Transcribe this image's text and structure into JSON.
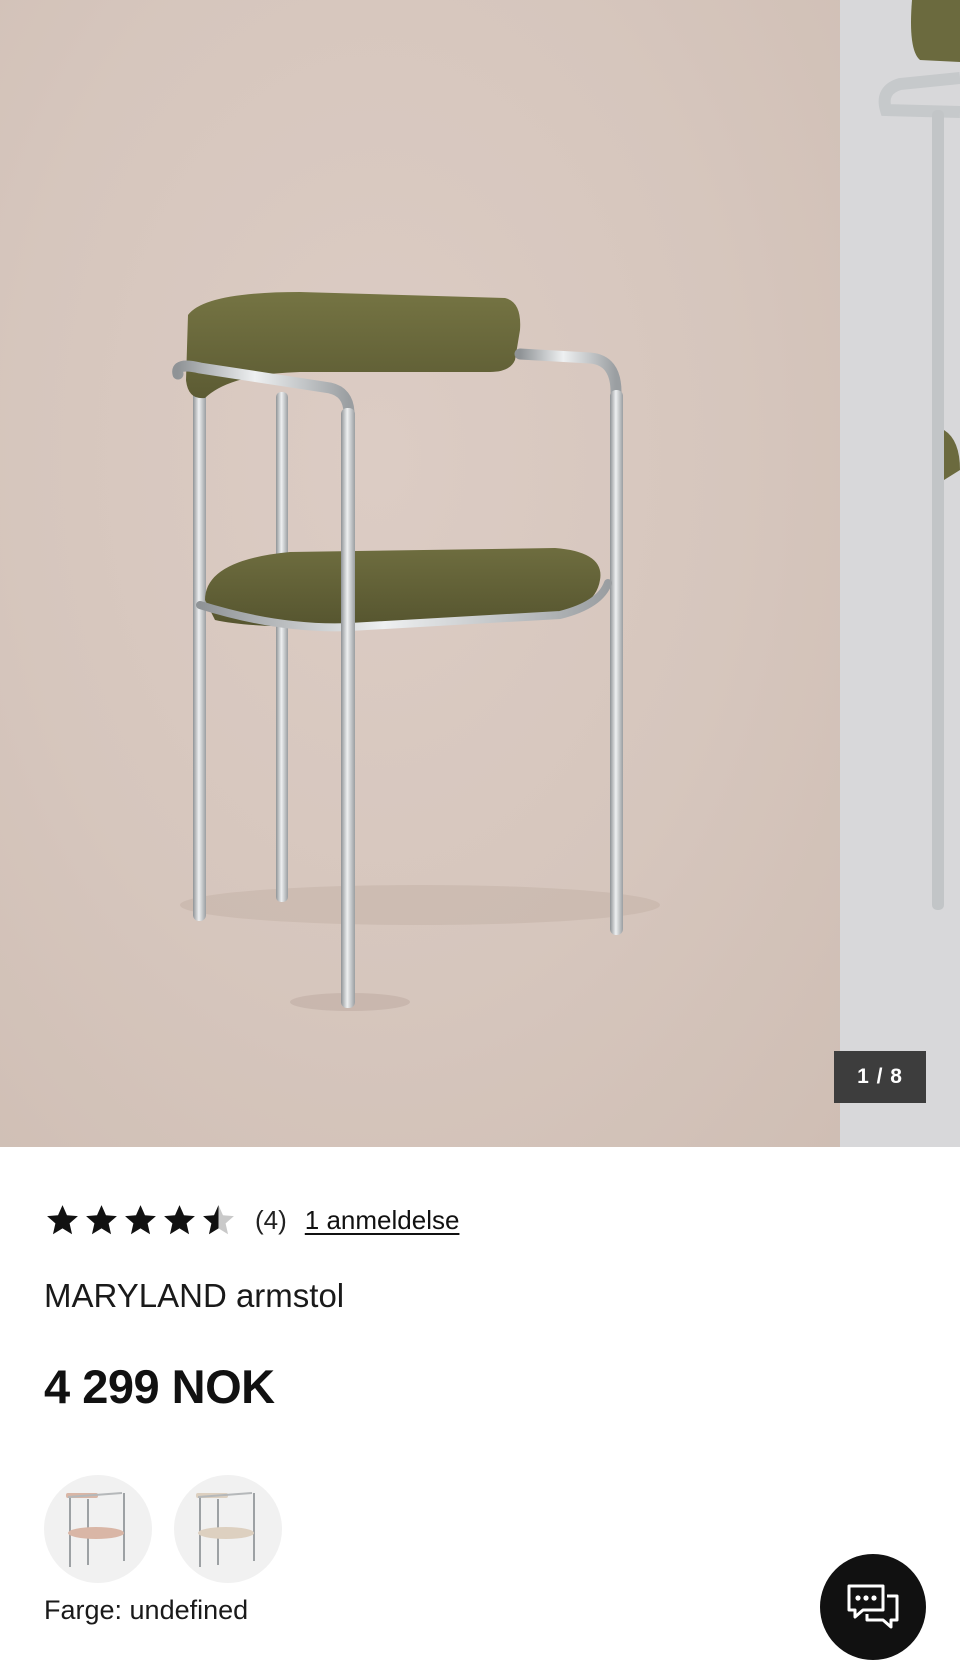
{
  "gallery": {
    "counter": "1 / 8",
    "current_slide": 1,
    "total_slides": 8
  },
  "product": {
    "rating": 4.5,
    "rating_count": "(4)",
    "review_link": "1 anmeldelse",
    "title": "MARYLAND armstol",
    "price": "4 299 NOK",
    "color_label": "Farge: undefined",
    "swatches": [
      {
        "name": "pink-seat-swatch",
        "seat_color": "#d9b6a6"
      },
      {
        "name": "beige-seat-swatch",
        "seat_color": "#ddd0c0"
      }
    ]
  },
  "colors": {
    "chair_fabric": "#6b6a3e",
    "chrome": "#b9bcbe",
    "backdrop": "#d6c6bd",
    "counter_bg": "#3d3d3d",
    "chat_bg": "#111111"
  },
  "icons": [
    "star-icon",
    "half-star-icon",
    "chat-icon"
  ]
}
